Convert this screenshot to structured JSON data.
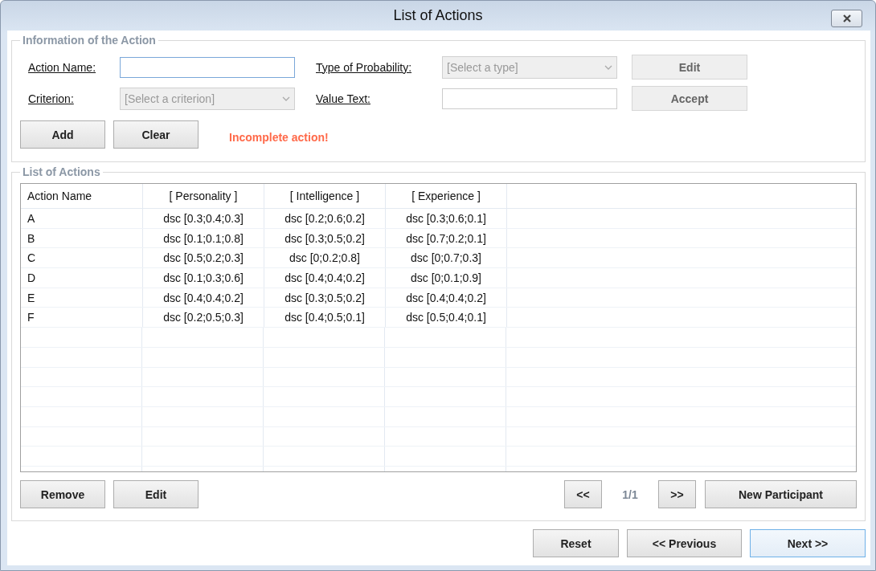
{
  "window": {
    "title": "List of Actions"
  },
  "info_group": {
    "title": "Information of the Action",
    "action_name": {
      "label": "Action Name:",
      "focused": true
    },
    "criterion": {
      "label": "Criterion:",
      "placeholder": "[Select a criterion]",
      "disabled": true
    },
    "type_of_probability": {
      "label": "Type of Probability:",
      "placeholder": "[Select a type]",
      "disabled": true
    },
    "value_text": {
      "label": "Value Text:"
    },
    "side_buttons": [
      {
        "label": "Edit",
        "disabled": true
      },
      {
        "label": "Accept",
        "disabled": true
      }
    ],
    "buttons": [
      {
        "label": "Add",
        "disabled": false
      },
      {
        "label": "Clear",
        "disabled": false
      }
    ],
    "message": "Incomplete action!"
  },
  "list_group": {
    "title": "List of Actions",
    "table": {
      "columns": [
        "Action Name",
        "[ Personality ]",
        "[ Intelligence ]",
        "[ Experience ]"
      ],
      "rows": [
        [
          "A",
          "dsc [0.3;0.4;0.3]",
          "dsc [0.2;0.6;0.2]",
          "dsc [0.3;0.6;0.1]"
        ],
        [
          "B",
          "dsc [0.1;0.1;0.8]",
          "dsc [0.3;0.5;0.2]",
          "dsc [0.7;0.2;0.1]"
        ],
        [
          "C",
          "dsc [0.5;0.2;0.3]",
          "dsc [0;0.2;0.8]",
          "dsc [0;0.7;0.3]"
        ],
        [
          "D",
          "dsc [0.1;0.3;0.6]",
          "dsc [0.4;0.4;0.2]",
          "dsc [0;0.1;0.9]"
        ],
        [
          "E",
          "dsc [0.4;0.4;0.2]",
          "dsc [0.3;0.5;0.2]",
          "dsc [0.4;0.4;0.2]"
        ],
        [
          "F",
          "dsc [0.2;0.5;0.3]",
          "dsc [0.4;0.5;0.1]",
          "dsc [0.5;0.4;0.1]"
        ]
      ]
    },
    "left_buttons": [
      {
        "label": "Remove"
      },
      {
        "label": "Edit"
      }
    ],
    "prev_page": "<<",
    "page": "1/1",
    "next_page": ">>",
    "new_button": "New Participant"
  },
  "footer_buttons": [
    {
      "label": "Reset",
      "focused": false
    },
    {
      "label": "<< Previous",
      "focused": false
    },
    {
      "label": "Next >>",
      "focused": true
    }
  ]
}
